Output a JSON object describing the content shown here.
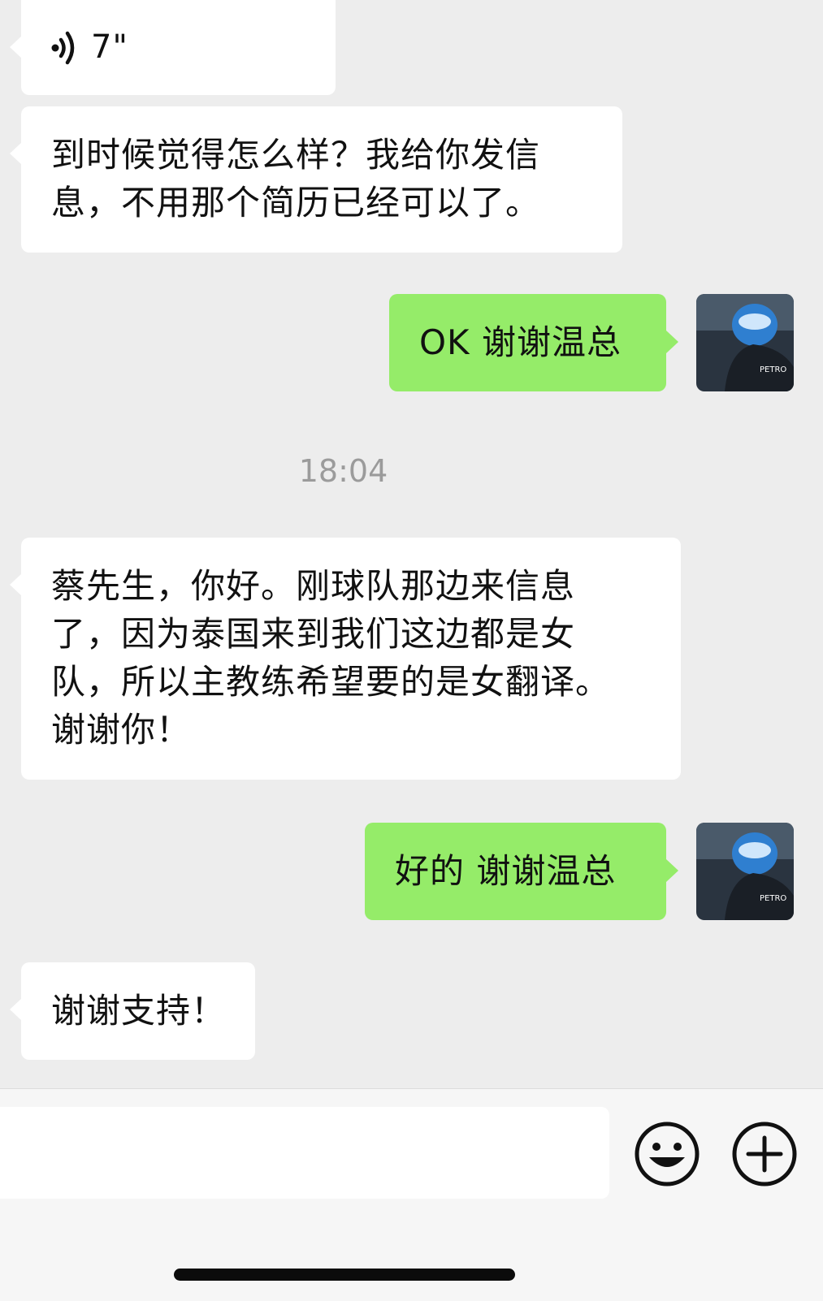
{
  "messages": [
    {
      "side": "in",
      "type": "voice",
      "duration": "7\""
    },
    {
      "side": "in",
      "type": "text",
      "lines": [
        "到时候觉得怎么样？我给你发信",
        "息，不用那个简历已经可以了。"
      ]
    },
    {
      "side": "out",
      "type": "text",
      "text": "OK 谢谢温总"
    },
    {
      "side": "in",
      "type": "text",
      "lines": [
        "蔡先生，你好。刚球队那边来信息",
        "了，因为泰国来到我们这边都是女",
        "队，所以主教练希望要的是女翻译。",
        "谢谢你！"
      ]
    },
    {
      "side": "out",
      "type": "text",
      "text": "好的 谢谢温总"
    },
    {
      "side": "in",
      "type": "text",
      "text": "谢谢支持！"
    }
  ],
  "timestamp": "18:04",
  "input_bar": {
    "input_value": "",
    "emoji_icon": "emoji-smile-icon",
    "more_icon": "plus-circle-icon"
  },
  "colors": {
    "background": "#ededed",
    "incoming_bubble": "#ffffff",
    "outgoing_bubble": "#95ec69",
    "timestamp": "#9b9b9b"
  }
}
